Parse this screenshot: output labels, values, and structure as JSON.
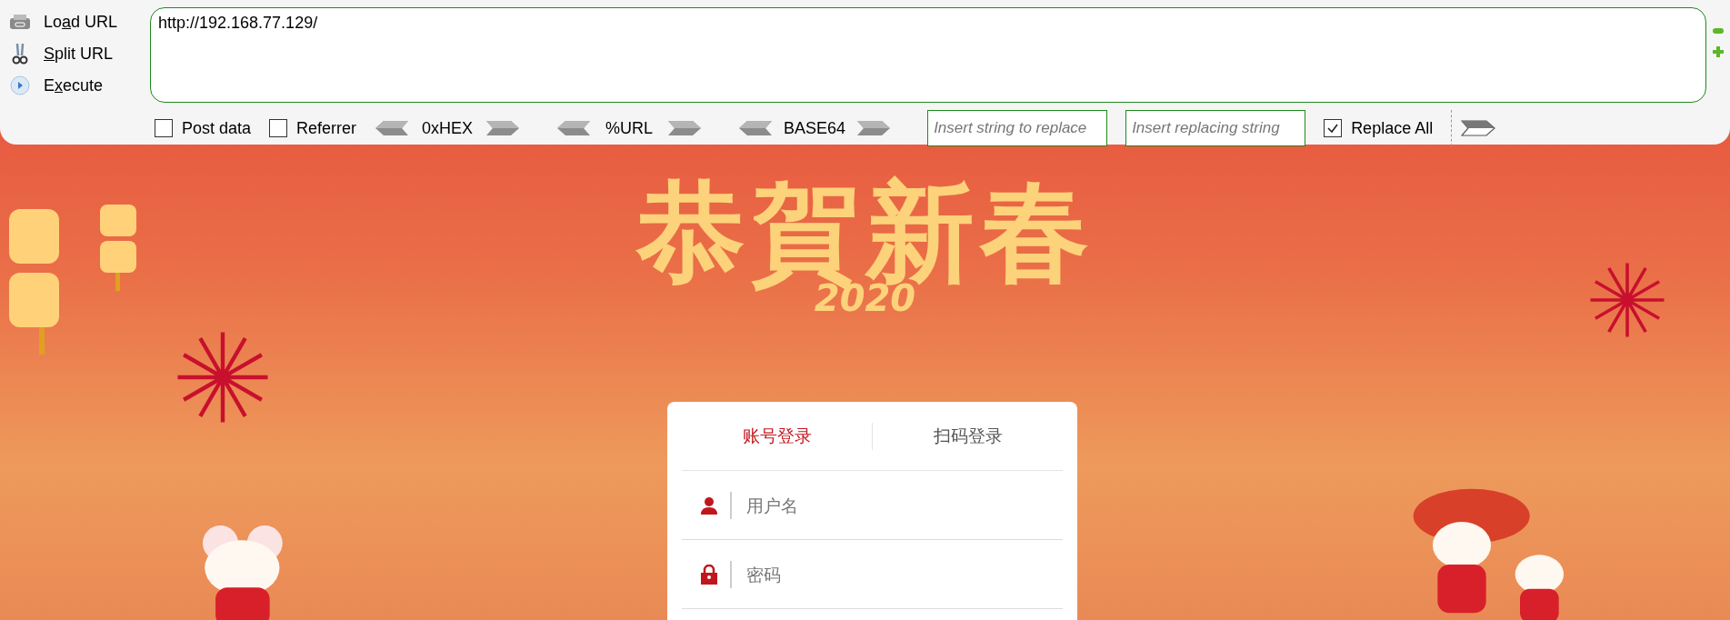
{
  "toolbar": {
    "actions": [
      {
        "kind": "load",
        "before": "Lo",
        "key": "a",
        "after": "d URL"
      },
      {
        "kind": "split",
        "key": "S",
        "after": "plit URL"
      },
      {
        "kind": "execute",
        "before": "E",
        "key": "x",
        "after": "ecute"
      }
    ],
    "url": "http://192.168.77.129/",
    "options": [
      {
        "kind": "checkbox",
        "label": "Post data",
        "checked": false
      },
      {
        "kind": "checkbox",
        "label": "Referrer",
        "checked": false
      },
      {
        "kind": "codec",
        "label": "0xHEX"
      },
      {
        "kind": "codec",
        "label": "%URL"
      },
      {
        "kind": "codec",
        "label": "BASE64"
      },
      {
        "kind": "field",
        "placeholder": "Insert string to replace"
      },
      {
        "kind": "field",
        "placeholder": "Insert replacing string"
      },
      {
        "kind": "checkbox",
        "label": "Replace All",
        "checked": true
      },
      {
        "kind": "go"
      }
    ]
  },
  "banner": {
    "title": "恭賀新春",
    "year": "2020"
  },
  "login": {
    "tabs": [
      {
        "label": "账号登录",
        "selected": true
      },
      {
        "label": "扫码登录",
        "selected": false
      }
    ],
    "fields": [
      {
        "kind": "user",
        "placeholder": "用户名"
      },
      {
        "kind": "lock",
        "placeholder": "密码"
      }
    ]
  }
}
